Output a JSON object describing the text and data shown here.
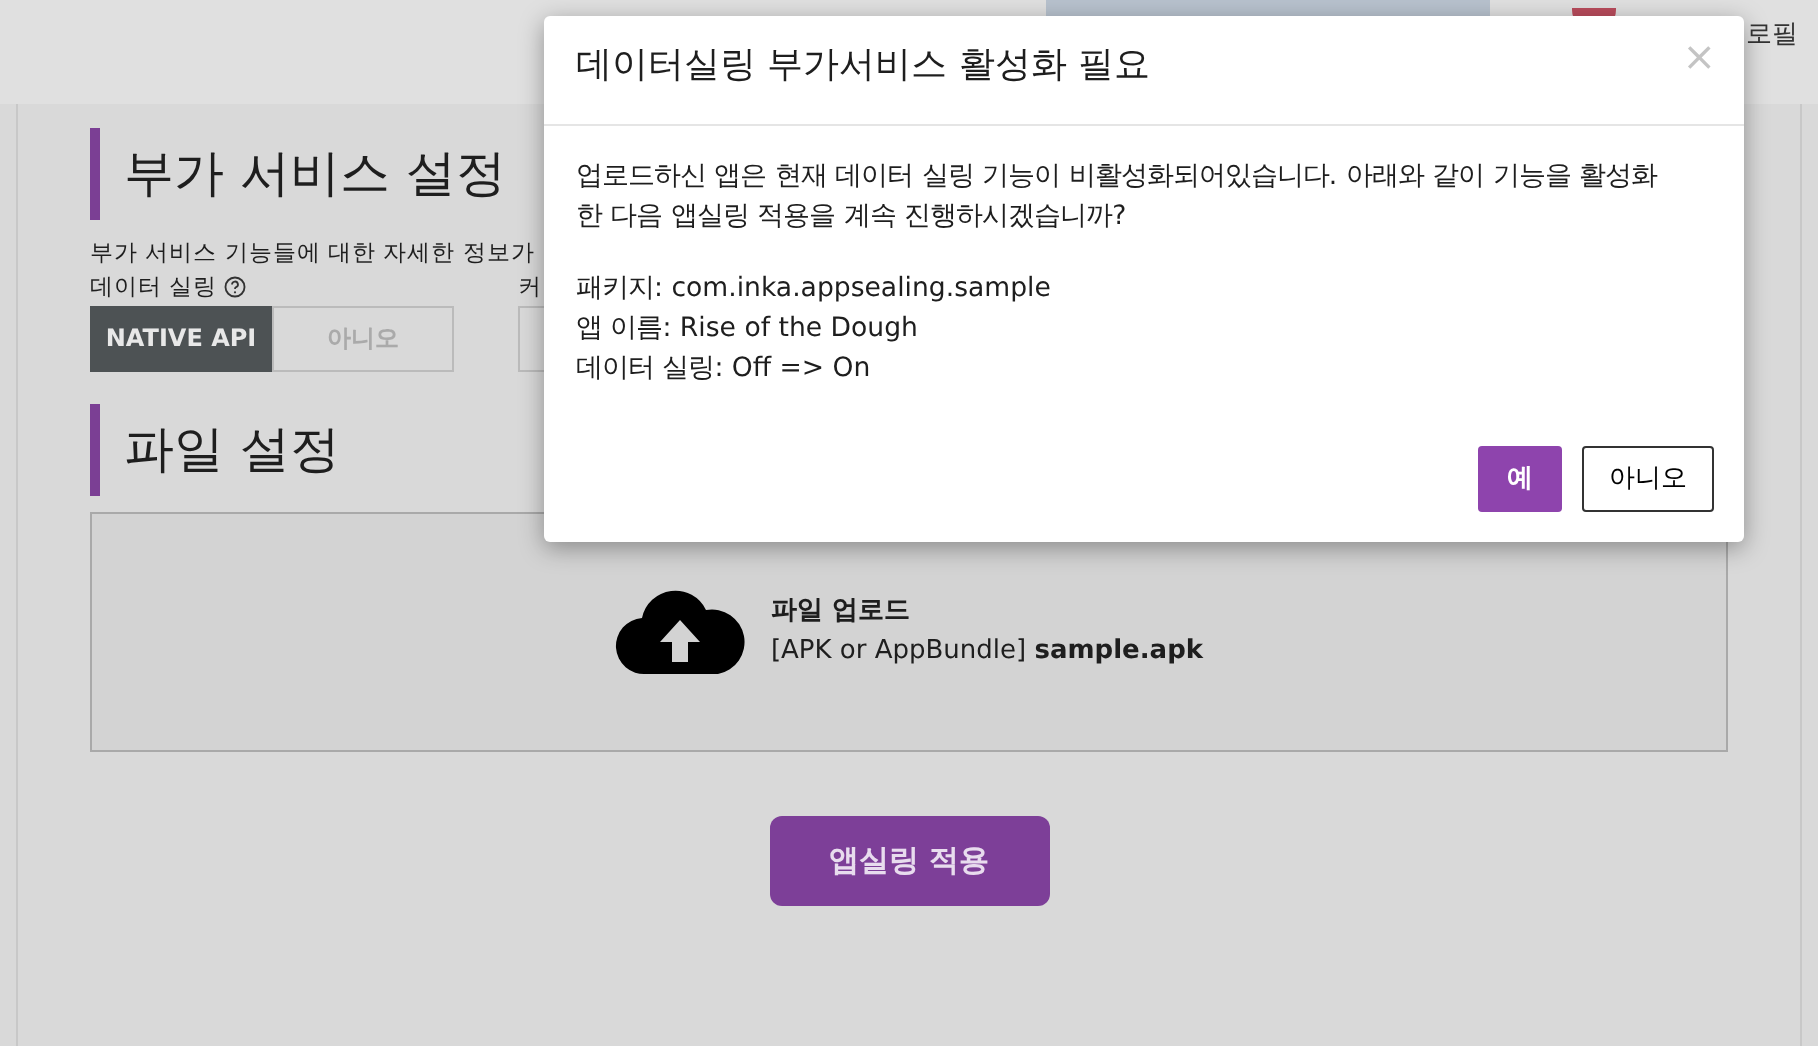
{
  "header": {
    "profile_label": "로필"
  },
  "sections": [
    {
      "title": "부가 서비스 설정",
      "description": "부가 서비스 기능들에 대한 자세한 정보가",
      "fields": [
        {
          "kind": "toggle",
          "label": "데이터 실링",
          "options": [
            {
              "label": "NATIVE API",
              "selected": true
            },
            {
              "label": "아니오",
              "selected": false
            }
          ]
        },
        {
          "kind": "input",
          "label": "커"
        }
      ]
    },
    {
      "title": "파일 설정",
      "upload": {
        "title": "파일 업로드",
        "hint": "[APK or AppBundle] **sample.apk**"
      }
    }
  ],
  "apply_button": "앱실링 적용",
  "modal": {
    "title": "데이터실링 부가서비스 활성화 필요",
    "close": "×",
    "message": "업로드하신 앱은 현재 데이터 실링 기능이 비활성화되어있습니다. 아래와 같이 기능을 활성화한 다음 앱실링 적용을 계속 진행하시겠습니까?",
    "details": [
      "패키지: com.inka.appsealing.sample",
      "앱 이름: Rise of the Dough",
      "데이터 실링: Off => On"
    ],
    "buttons": [
      {
        "label": "예",
        "kind": "primary"
      },
      {
        "label": "아니오",
        "kind": "outline"
      }
    ]
  }
}
